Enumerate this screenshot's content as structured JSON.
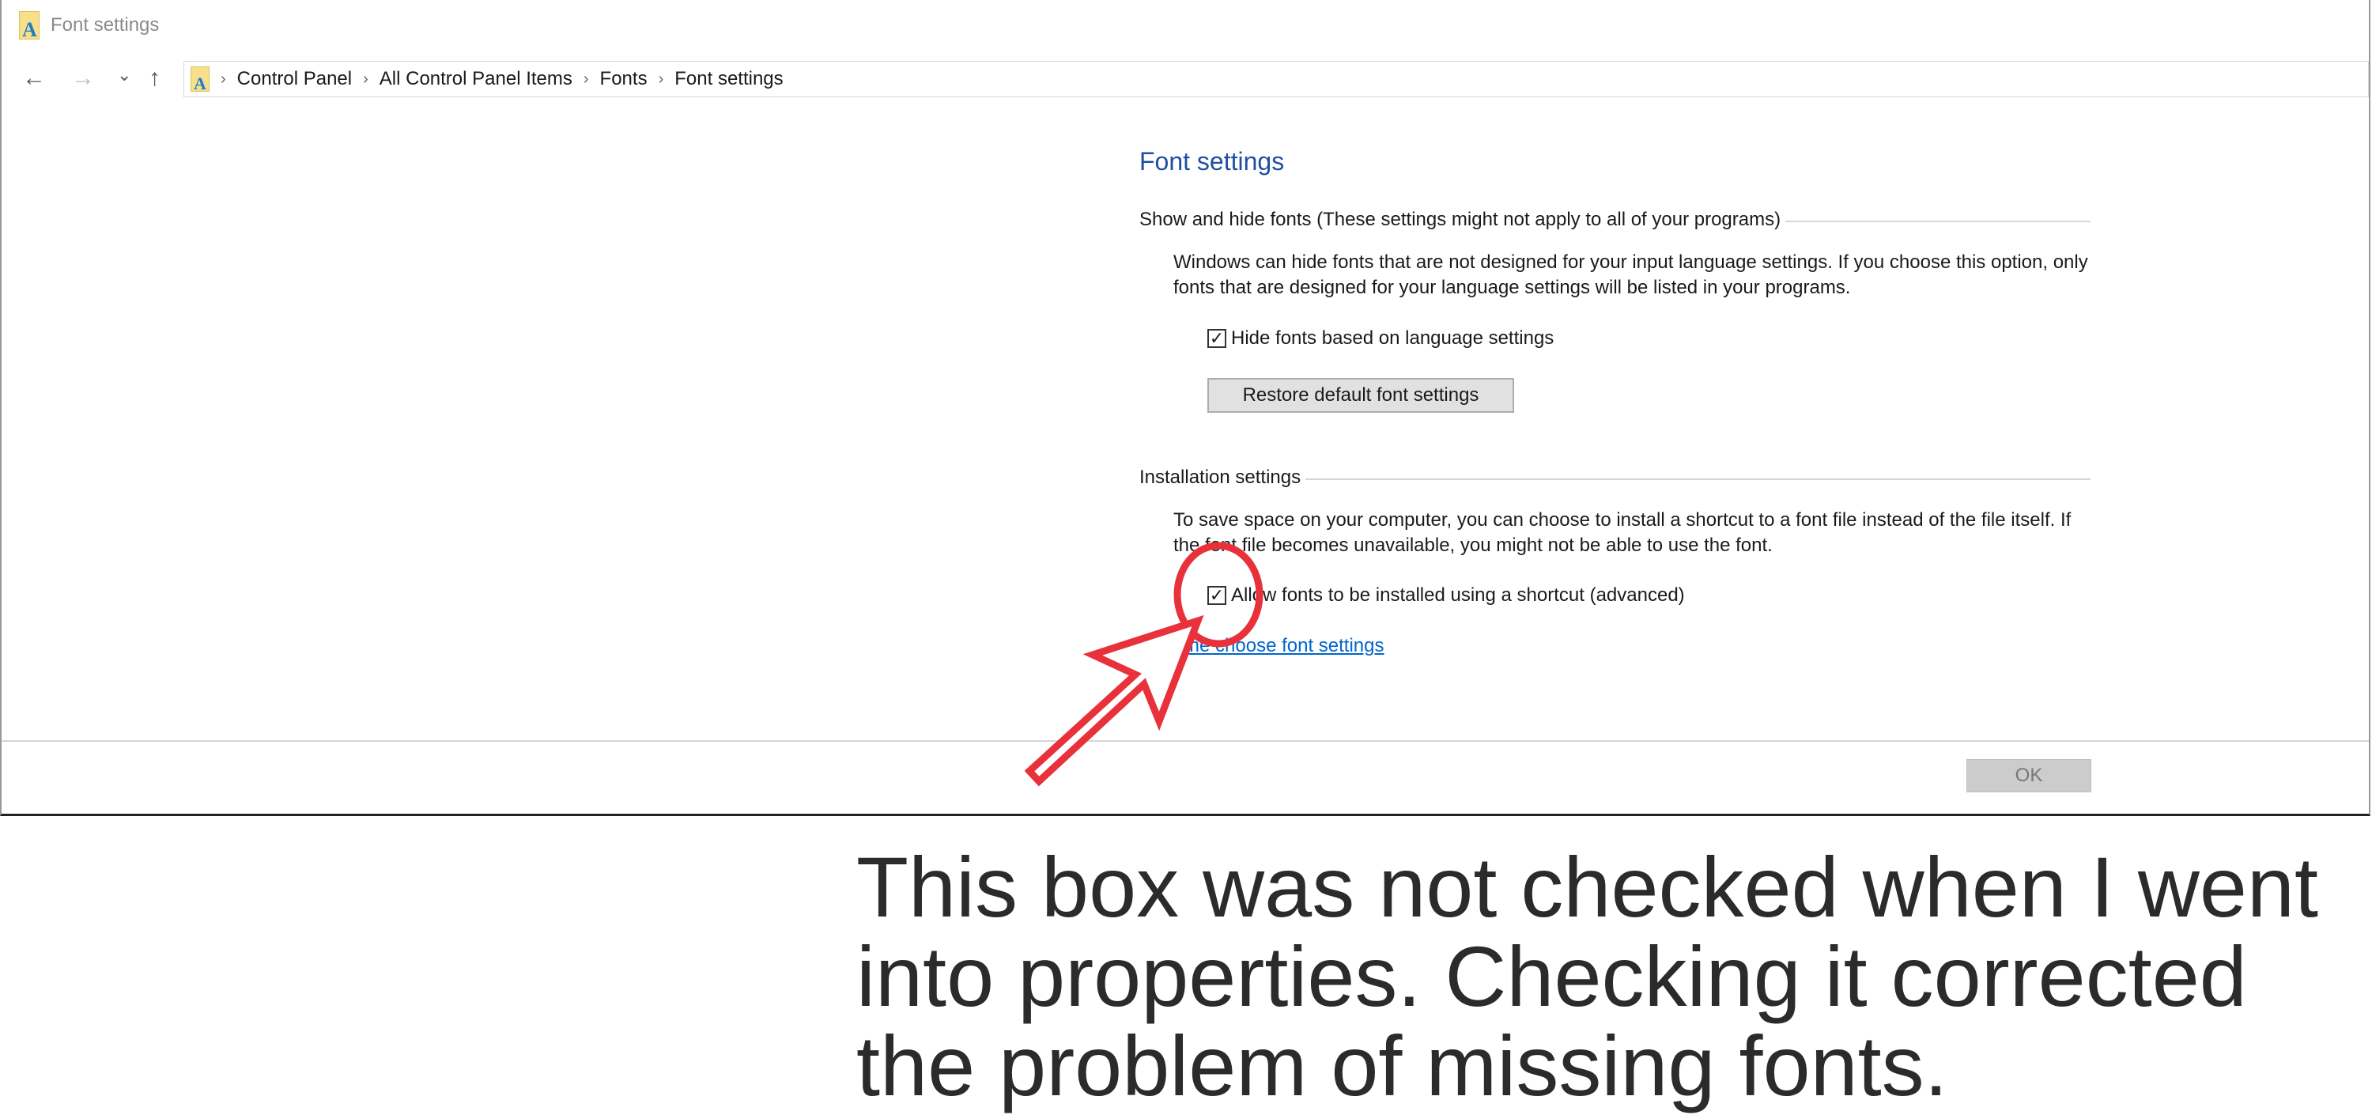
{
  "window": {
    "title": "Font settings",
    "icon": "fonts-folder-icon"
  },
  "nav": {
    "back": "←",
    "forward": "→",
    "recent": "⌄",
    "up": "↑",
    "breadcrumb": [
      "Control Panel",
      "All Control Panel Items",
      "Fonts",
      "Font settings"
    ],
    "separator": "›"
  },
  "main": {
    "heading": "Font settings",
    "show_hide": {
      "title": "Show and hide fonts (These settings might not apply to all of your programs)",
      "description": "Windows can hide fonts that are not designed for your input language settings. If you choose this option, only fonts that are designed for your language settings will be listed in your programs.",
      "checkbox_label": "Hide fonts based on language settings",
      "checkbox_checked": true,
      "restore_button": "Restore default font settings"
    },
    "installation": {
      "title": "Installation settings",
      "description": "To save space on your computer, you can choose to install a shortcut to a font file instead of the file itself. If the font file becomes unavailable, you might not be able to use the font.",
      "checkbox_label": "Allow fonts to be installed using a shortcut (advanced)",
      "checkbox_checked": true
    },
    "help_link": "Help me choose font settings",
    "ok_button": "OK",
    "check_mark": "✓"
  },
  "annotation": {
    "text": "This box was not checked when I went into properties.  Checking it corrected the problem of missing fonts.",
    "color": "#e8313a"
  }
}
